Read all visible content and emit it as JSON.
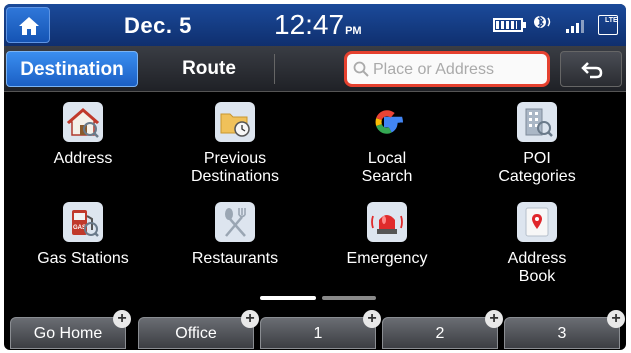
{
  "status": {
    "date": "Dec.  5",
    "time": "12:47",
    "ampm": "PM",
    "lte": "LTE"
  },
  "tabs": {
    "destination": "Destination",
    "route": "Route"
  },
  "search": {
    "placeholder": "Place or Address"
  },
  "grid": [
    {
      "label": "Address",
      "icon": "house-icon"
    },
    {
      "label": "Previous\nDestinations",
      "icon": "folder-clock-icon"
    },
    {
      "label": "Local\nSearch",
      "icon": "google-icon"
    },
    {
      "label": "POI\nCategories",
      "icon": "building-icon"
    },
    {
      "label": "Gas Stations",
      "icon": "gas-pump-icon"
    },
    {
      "label": "Restaurants",
      "icon": "fork-spoon-icon"
    },
    {
      "label": "Emergency",
      "icon": "siren-icon"
    },
    {
      "label": "Address\nBook",
      "icon": "address-book-icon"
    }
  ],
  "favorites": [
    {
      "label": "Go Home"
    },
    {
      "label": "Office"
    },
    {
      "label": "1"
    },
    {
      "label": "2"
    },
    {
      "label": "3"
    }
  ],
  "colors": {
    "statusbar": "#143c85",
    "active_tab": "#2a78e0",
    "search_border": "#e5412f"
  }
}
